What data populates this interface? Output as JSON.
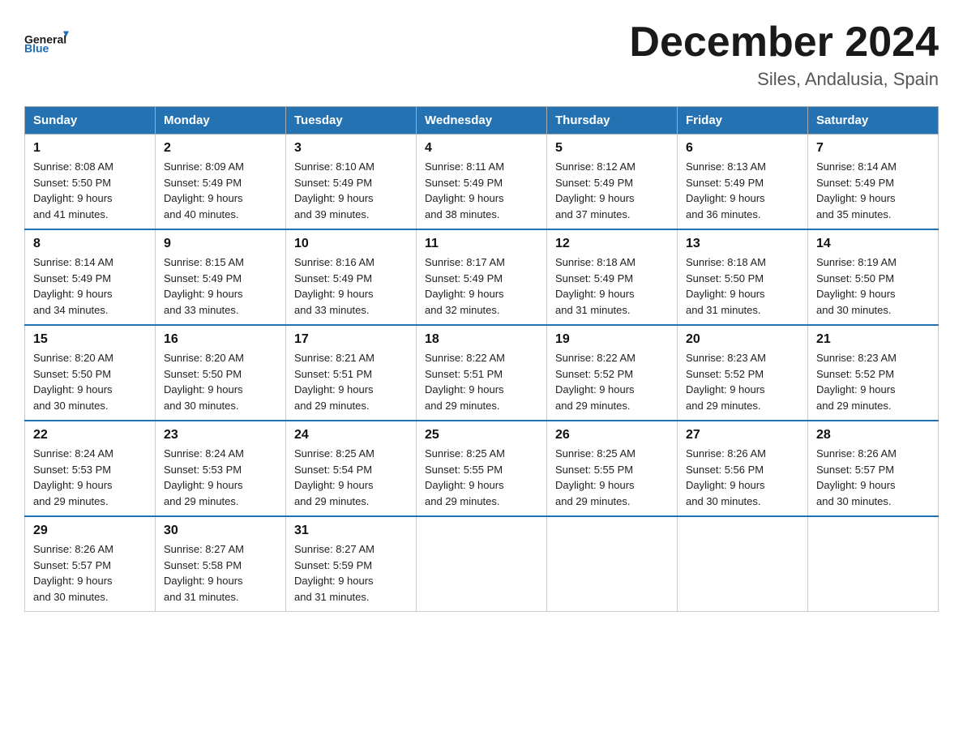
{
  "header": {
    "logo_general": "General",
    "logo_blue": "Blue",
    "month_title": "December 2024",
    "location": "Siles, Andalusia, Spain"
  },
  "days_of_week": [
    "Sunday",
    "Monday",
    "Tuesday",
    "Wednesday",
    "Thursday",
    "Friday",
    "Saturday"
  ],
  "weeks": [
    [
      {
        "day": "1",
        "sunrise": "8:08 AM",
        "sunset": "5:50 PM",
        "daylight": "9 hours and 41 minutes."
      },
      {
        "day": "2",
        "sunrise": "8:09 AM",
        "sunset": "5:49 PM",
        "daylight": "9 hours and 40 minutes."
      },
      {
        "day": "3",
        "sunrise": "8:10 AM",
        "sunset": "5:49 PM",
        "daylight": "9 hours and 39 minutes."
      },
      {
        "day": "4",
        "sunrise": "8:11 AM",
        "sunset": "5:49 PM",
        "daylight": "9 hours and 38 minutes."
      },
      {
        "day": "5",
        "sunrise": "8:12 AM",
        "sunset": "5:49 PM",
        "daylight": "9 hours and 37 minutes."
      },
      {
        "day": "6",
        "sunrise": "8:13 AM",
        "sunset": "5:49 PM",
        "daylight": "9 hours and 36 minutes."
      },
      {
        "day": "7",
        "sunrise": "8:14 AM",
        "sunset": "5:49 PM",
        "daylight": "9 hours and 35 minutes."
      }
    ],
    [
      {
        "day": "8",
        "sunrise": "8:14 AM",
        "sunset": "5:49 PM",
        "daylight": "9 hours and 34 minutes."
      },
      {
        "day": "9",
        "sunrise": "8:15 AM",
        "sunset": "5:49 PM",
        "daylight": "9 hours and 33 minutes."
      },
      {
        "day": "10",
        "sunrise": "8:16 AM",
        "sunset": "5:49 PM",
        "daylight": "9 hours and 33 minutes."
      },
      {
        "day": "11",
        "sunrise": "8:17 AM",
        "sunset": "5:49 PM",
        "daylight": "9 hours and 32 minutes."
      },
      {
        "day": "12",
        "sunrise": "8:18 AM",
        "sunset": "5:49 PM",
        "daylight": "9 hours and 31 minutes."
      },
      {
        "day": "13",
        "sunrise": "8:18 AM",
        "sunset": "5:50 PM",
        "daylight": "9 hours and 31 minutes."
      },
      {
        "day": "14",
        "sunrise": "8:19 AM",
        "sunset": "5:50 PM",
        "daylight": "9 hours and 30 minutes."
      }
    ],
    [
      {
        "day": "15",
        "sunrise": "8:20 AM",
        "sunset": "5:50 PM",
        "daylight": "9 hours and 30 minutes."
      },
      {
        "day": "16",
        "sunrise": "8:20 AM",
        "sunset": "5:50 PM",
        "daylight": "9 hours and 30 minutes."
      },
      {
        "day": "17",
        "sunrise": "8:21 AM",
        "sunset": "5:51 PM",
        "daylight": "9 hours and 29 minutes."
      },
      {
        "day": "18",
        "sunrise": "8:22 AM",
        "sunset": "5:51 PM",
        "daylight": "9 hours and 29 minutes."
      },
      {
        "day": "19",
        "sunrise": "8:22 AM",
        "sunset": "5:52 PM",
        "daylight": "9 hours and 29 minutes."
      },
      {
        "day": "20",
        "sunrise": "8:23 AM",
        "sunset": "5:52 PM",
        "daylight": "9 hours and 29 minutes."
      },
      {
        "day": "21",
        "sunrise": "8:23 AM",
        "sunset": "5:52 PM",
        "daylight": "9 hours and 29 minutes."
      }
    ],
    [
      {
        "day": "22",
        "sunrise": "8:24 AM",
        "sunset": "5:53 PM",
        "daylight": "9 hours and 29 minutes."
      },
      {
        "day": "23",
        "sunrise": "8:24 AM",
        "sunset": "5:53 PM",
        "daylight": "9 hours and 29 minutes."
      },
      {
        "day": "24",
        "sunrise": "8:25 AM",
        "sunset": "5:54 PM",
        "daylight": "9 hours and 29 minutes."
      },
      {
        "day": "25",
        "sunrise": "8:25 AM",
        "sunset": "5:55 PM",
        "daylight": "9 hours and 29 minutes."
      },
      {
        "day": "26",
        "sunrise": "8:25 AM",
        "sunset": "5:55 PM",
        "daylight": "9 hours and 29 minutes."
      },
      {
        "day": "27",
        "sunrise": "8:26 AM",
        "sunset": "5:56 PM",
        "daylight": "9 hours and 30 minutes."
      },
      {
        "day": "28",
        "sunrise": "8:26 AM",
        "sunset": "5:57 PM",
        "daylight": "9 hours and 30 minutes."
      }
    ],
    [
      {
        "day": "29",
        "sunrise": "8:26 AM",
        "sunset": "5:57 PM",
        "daylight": "9 hours and 30 minutes."
      },
      {
        "day": "30",
        "sunrise": "8:27 AM",
        "sunset": "5:58 PM",
        "daylight": "9 hours and 31 minutes."
      },
      {
        "day": "31",
        "sunrise": "8:27 AM",
        "sunset": "5:59 PM",
        "daylight": "9 hours and 31 minutes."
      },
      null,
      null,
      null,
      null
    ]
  ],
  "labels": {
    "sunrise": "Sunrise:",
    "sunset": "Sunset:",
    "daylight": "Daylight:"
  }
}
